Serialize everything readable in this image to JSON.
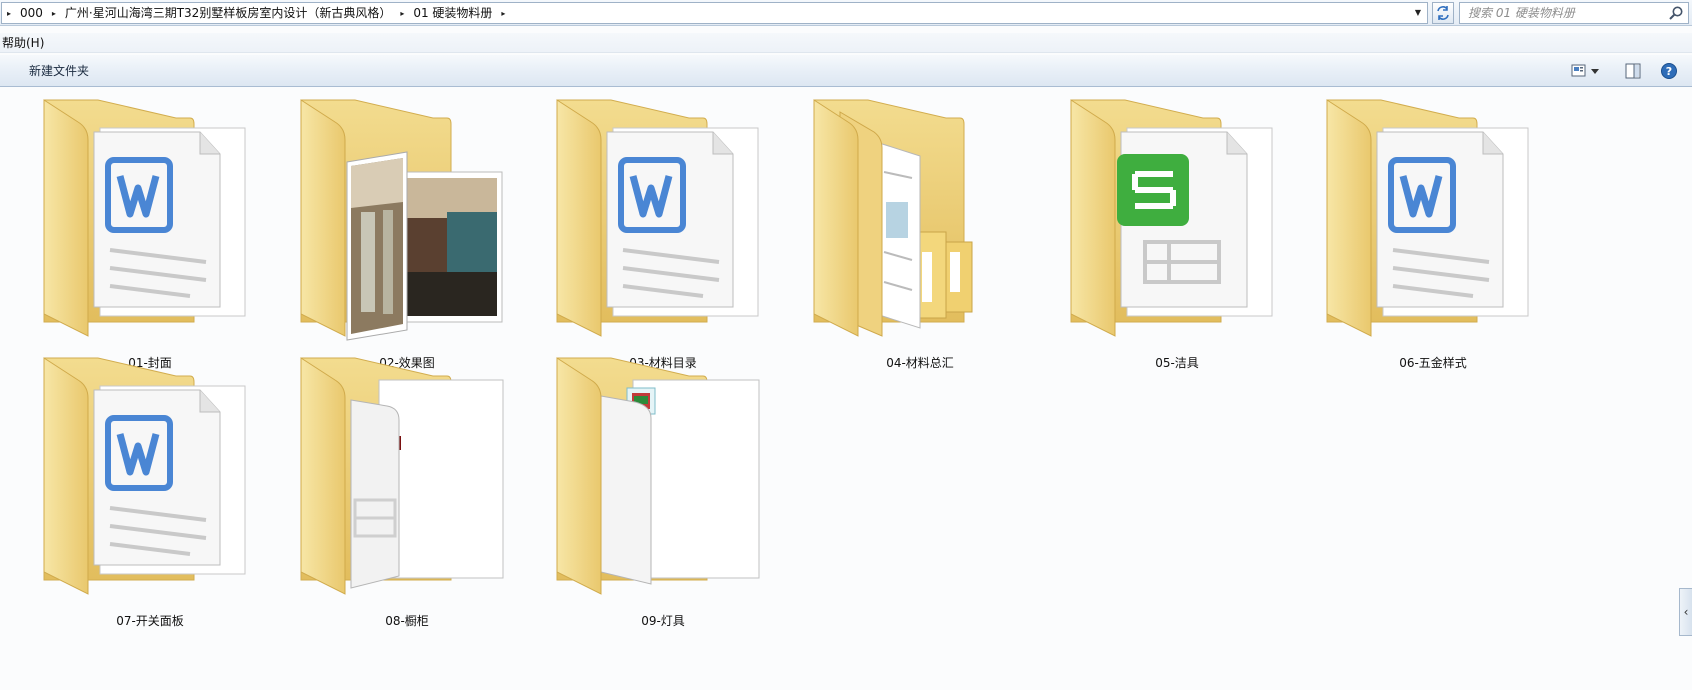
{
  "addressbar": {
    "crumbs": [
      "000",
      "广州·星河山海湾三期T32别墅样板房室内设计（新古典风格）",
      "01 硬装物料册"
    ],
    "search_placeholder": "搜索 01 硬装物料册"
  },
  "menubar": {
    "help_label": "帮助(H)"
  },
  "commandbar": {
    "new_folder_label": "新建文件夹"
  },
  "folders": [
    {
      "name": "01-封面",
      "preview": "word-doc"
    },
    {
      "name": "02-效果图",
      "preview": "photos"
    },
    {
      "name": "03-材料目录",
      "preview": "word-doc"
    },
    {
      "name": "04-材料总汇",
      "preview": "documents-stack"
    },
    {
      "name": "05-洁具",
      "preview": "spreadsheet"
    },
    {
      "name": "06-五金样式",
      "preview": "word-doc"
    },
    {
      "name": "07-开关面板",
      "preview": "word-doc"
    },
    {
      "name": "08-橱柜",
      "preview": "documents-pages"
    },
    {
      "name": "09-灯具",
      "preview": "documents-pages"
    }
  ],
  "colors": {
    "folder_front": "#f1d889",
    "folder_back": "#e6c468",
    "word_blue": "#4a86d4",
    "sheet_green": "#3fae3f"
  }
}
